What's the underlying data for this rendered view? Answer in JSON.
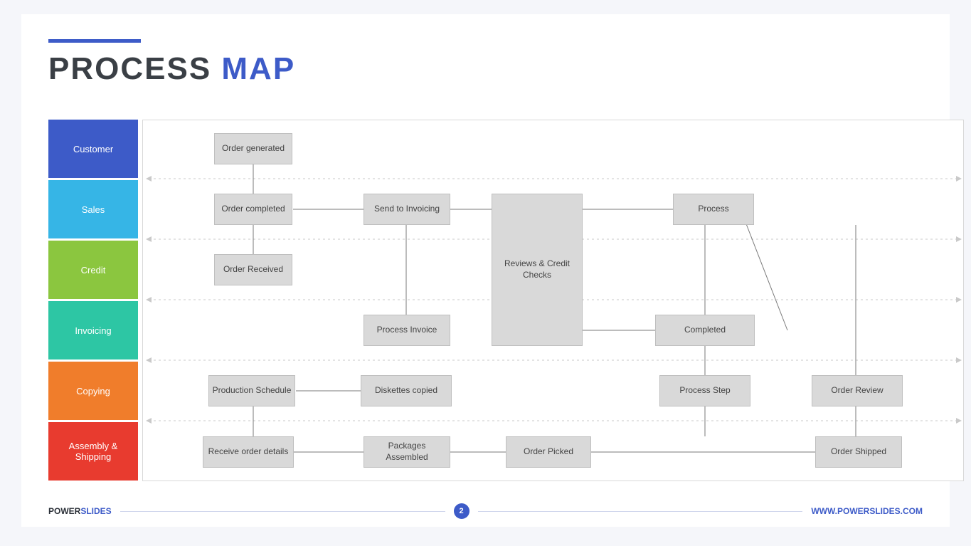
{
  "title": {
    "w1": "PROCESS",
    "w2": "MAP"
  },
  "lanes": [
    "Customer",
    "Sales",
    "Credit",
    "Invoicing",
    "Copying",
    "Assembly & Shipping"
  ],
  "boxes": {
    "order_generated": "Order generated",
    "order_completed": "Order completed",
    "send_invoicing": "Send to Invoicing",
    "process": "Process",
    "order_received": "Order Received",
    "reviews": "Reviews & Credit Checks",
    "process_invoice": "Process Invoice",
    "completed": "Completed",
    "production_schedule": "Production Schedule",
    "diskettes": "Diskettes copied",
    "process_step": "Process Step",
    "order_review": "Order Review",
    "receive_details": "Receive order details",
    "packages": "Packages Assembled",
    "order_picked": "Order Picked",
    "order_shipped": "Order Shipped"
  },
  "footer": {
    "brand1": "POWER",
    "brand2": "SLIDES",
    "page": "2",
    "url": "WWW.POWERSLIDES.COM"
  }
}
